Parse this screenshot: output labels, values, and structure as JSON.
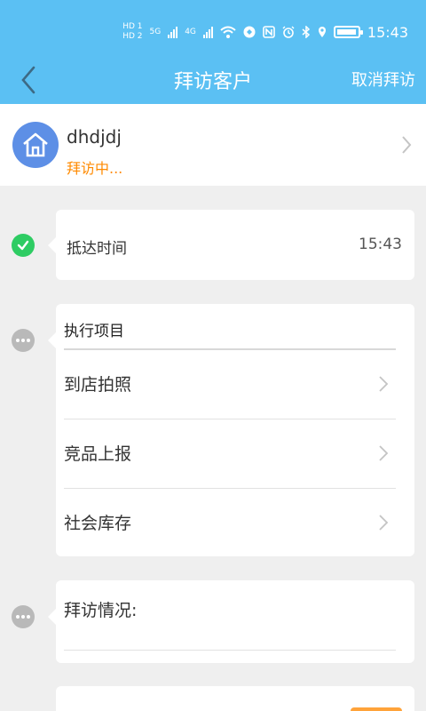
{
  "status_bar": {
    "hd_labels": [
      "HD 1",
      "HD 2"
    ],
    "net_labels": [
      "5G",
      "4G"
    ],
    "time": "15:43"
  },
  "nav": {
    "title": "拜访客户",
    "right_action": "取消拜访"
  },
  "customer": {
    "name": "dhdjdj",
    "status": "拜访中..."
  },
  "arrival": {
    "label": "抵达时间",
    "time": "15:43"
  },
  "execution": {
    "title": "执行项目",
    "items": [
      {
        "label": "到店拍照"
      },
      {
        "label": "竞品上报"
      },
      {
        "label": "社会库存"
      }
    ]
  },
  "situation": {
    "label": "拜访情况:"
  },
  "colors": {
    "header": "#5bc0f3",
    "accent_orange": "#ff8a00",
    "success_green": "#2ecc63",
    "avatar_blue": "#5d8fe6"
  }
}
